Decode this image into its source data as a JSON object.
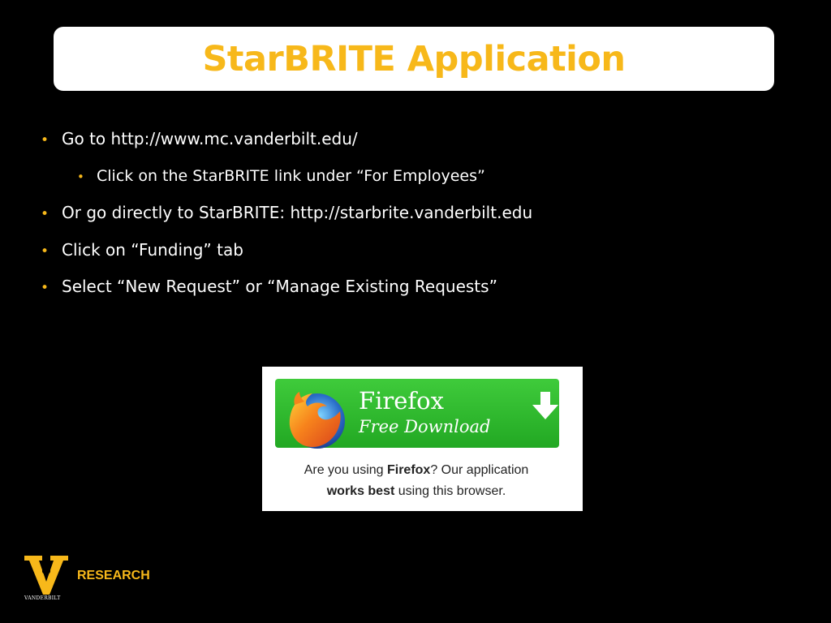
{
  "slide": {
    "title": "StarBRITE Application",
    "bullets": [
      {
        "text": "Go to http://www.mc.vanderbilt.edu/"
      },
      {
        "text": "Click on the StarBRITE link under “For Employees”"
      },
      {
        "text": "Or go directly to StarBRITE: http://starbrite.vanderbilt.edu"
      },
      {
        "text": "Click on “Funding” tab"
      },
      {
        "text": "Select “New Request” or “Manage Existing Requests”"
      }
    ],
    "bullet_glyph": "•"
  },
  "firefox_promo": {
    "name": "Firefox",
    "subtitle": "Free Download",
    "caption_part1": "Are you using ",
    "caption_bold1": "Firefox",
    "caption_part2": "? Our application",
    "caption_bold2": "works best",
    "caption_part3": " using this browser.",
    "icons": {
      "logo": "firefox-logo-icon",
      "arrow": "download-arrow-icon"
    }
  },
  "footer": {
    "logo_wordmark": "VANDERBILT",
    "label": "RESEARCH"
  },
  "colors": {
    "background": "#000000",
    "accent": "#f7b81a",
    "text": "#ffffff",
    "button_green": "#2bb52a"
  }
}
